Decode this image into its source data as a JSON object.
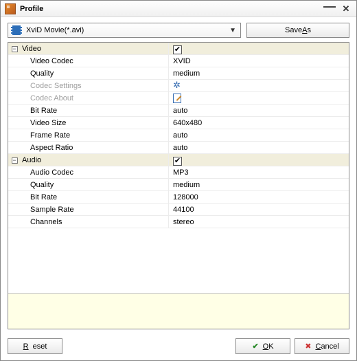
{
  "window": {
    "title": "Profile"
  },
  "toolbar": {
    "profile_selected": "XviD Movie(*.avi)",
    "saveas_prefix": "Save ",
    "saveas_ul": "A",
    "saveas_suffix": "s"
  },
  "groups": {
    "video": {
      "label": "Video",
      "checked": true
    },
    "audio": {
      "label": "Audio",
      "checked": true
    }
  },
  "video": {
    "codec_label": "Video Codec",
    "codec_value": "XVID",
    "quality_label": "Quality",
    "quality_value": "medium",
    "codec_settings_label": "Codec Settings",
    "codec_about_label": "Codec About",
    "bitrate_label": "Bit Rate",
    "bitrate_value": "auto",
    "size_label": "Video Size",
    "size_value": "640x480",
    "framerate_label": "Frame Rate",
    "framerate_value": "auto",
    "aspect_label": "Aspect Ratio",
    "aspect_value": "auto"
  },
  "audio": {
    "codec_label": "Audio Codec",
    "codec_value": "MP3",
    "quality_label": "Quality",
    "quality_value": "medium",
    "bitrate_label": "Bit Rate",
    "bitrate_value": "128000",
    "samplerate_label": "Sample Rate",
    "samplerate_value": "44100",
    "channels_label": "Channels",
    "channels_value": "stereo"
  },
  "footer": {
    "reset_ul": "R",
    "reset_suffix": "eset",
    "ok_ul": "O",
    "ok_suffix": "K",
    "cancel_ul": "C",
    "cancel_suffix": "ancel"
  }
}
